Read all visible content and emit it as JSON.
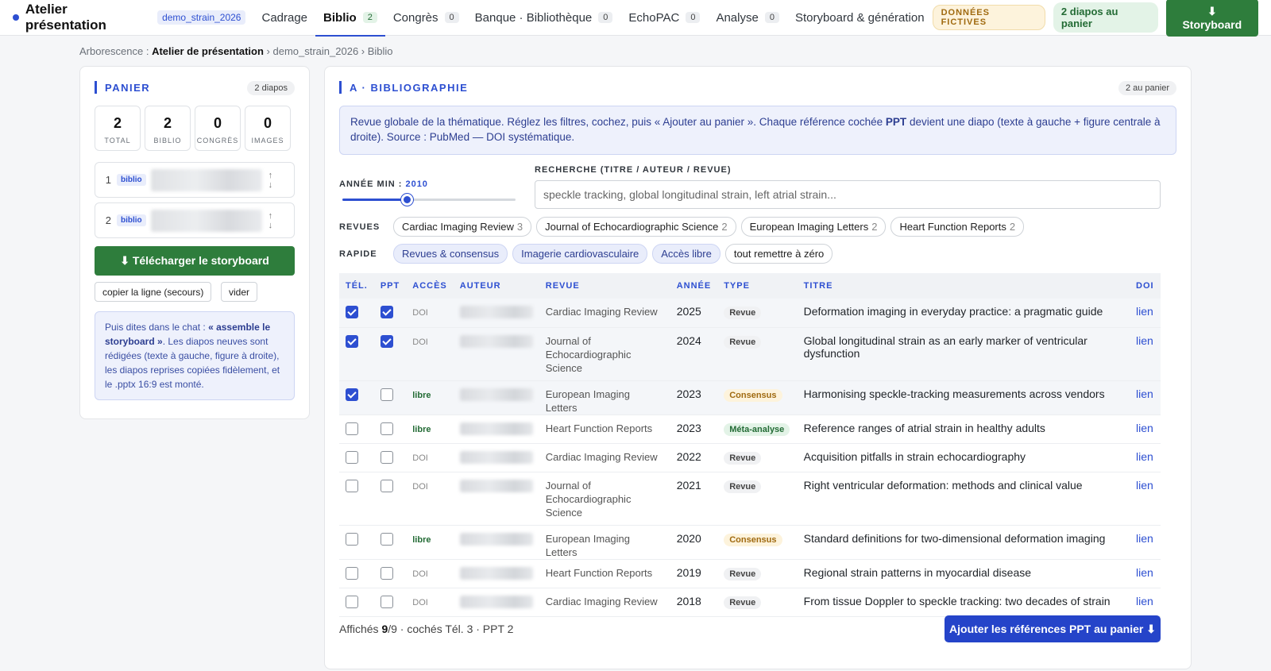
{
  "topbar": {
    "brand": "Atelier présentation",
    "project": "demo_strain_2026",
    "tabs": [
      {
        "label": "Cadrage",
        "count": null
      },
      {
        "label": "Biblio",
        "count": "2"
      },
      {
        "label": "Congrès",
        "count": "0"
      },
      {
        "label": "Banque · Bibliothèque",
        "count": "0"
      },
      {
        "label": "EchoPAC",
        "count": "0"
      },
      {
        "label": "Analyse",
        "count": "0"
      },
      {
        "label": "Storyboard & génération",
        "count": null
      }
    ],
    "fictive_badge": "DONNÉES FICTIVES",
    "cart_pill": "2 diapos au panier",
    "storyboard_button": "⬇ Storyboard"
  },
  "breadcrumb": {
    "prefix": "Arborescence :",
    "root": "Atelier de présentation",
    "path": " › demo_strain_2026 › Biblio"
  },
  "panier": {
    "title": "PANIER",
    "count": "2 diapos",
    "stats": [
      {
        "value": "2",
        "label": "TOTAL"
      },
      {
        "value": "2",
        "label": "BIBLIO"
      },
      {
        "value": "0",
        "label": "CONGRÈS"
      },
      {
        "value": "0",
        "label": "IMAGES"
      }
    ],
    "items": [
      {
        "index": "1",
        "type": "biblio"
      },
      {
        "index": "2",
        "type": "biblio"
      }
    ],
    "download_button": "⬇ Télécharger le storyboard",
    "copy_button": "copier la ligne (secours)",
    "clear_button": "vider",
    "hint_prefix": "Puis dites dans le chat : ",
    "hint_bold": "« assemble le storyboard »",
    "hint_suffix": ". Les diapos neuves sont rédigées (texte à gauche, figure à droite), les diapos reprises copiées fidèlement, et le .pptx 16:9 est monté."
  },
  "biblio": {
    "title": "A · BIBLIOGRAPHIE",
    "count": "2 au panier",
    "info_a": "Revue globale de la thématique. Réglez les filtres, cochez, puis « Ajouter au panier ». Chaque référence cochée ",
    "info_bold": "PPT",
    "info_b": " devient une diapo (texte à gauche + figure centrale à droite). Source : PubMed — DOI systématique.",
    "year_label": "ANNÉE MIN :",
    "year_value": "2010",
    "search_label": "RECHERCHE (TITRE / AUTEUR / REVUE)",
    "search_placeholder": "speckle tracking, global longitudinal strain, left atrial strain...",
    "revues_label": "REVUES",
    "revues": [
      {
        "name": "Cardiac Imaging Review",
        "count": "3"
      },
      {
        "name": "Journal of Echocardiographic Science",
        "count": "2"
      },
      {
        "name": "European Imaging Letters",
        "count": "2"
      },
      {
        "name": "Heart Function Reports",
        "count": "2"
      }
    ],
    "rapide_label": "RAPIDE",
    "rapide": [
      "Revues & consensus",
      "Imagerie cardiovasculaire",
      "Accès libre",
      "tout remettre à zéro"
    ],
    "columns": [
      "TÉL.",
      "PPT",
      "ACCÈS",
      "AUTEUR",
      "REVUE",
      "ANNÉE",
      "TYPE",
      "TITRE",
      "DOI"
    ],
    "rows": [
      {
        "tel": true,
        "ppt": true,
        "acces": "DOI",
        "revue": "Cardiac Imaging Review",
        "annee": "2025",
        "type": "Revue",
        "titre": "Deformation imaging in everyday practice: a pragmatic guide",
        "doi": "lien"
      },
      {
        "tel": true,
        "ppt": true,
        "acces": "DOI",
        "revue": "Journal of Echocardiographic Science",
        "annee": "2024",
        "type": "Revue",
        "titre": "Global longitudinal strain as an early marker of ventricular dysfunction",
        "doi": "lien"
      },
      {
        "tel": true,
        "ppt": false,
        "acces": "libre",
        "revue": "European Imaging Letters",
        "annee": "2023",
        "type": "Consensus",
        "titre": "Harmonising speckle-tracking measurements across vendors",
        "doi": "lien"
      },
      {
        "tel": false,
        "ppt": false,
        "acces": "libre",
        "revue": "Heart Function Reports",
        "annee": "2023",
        "type": "Méta-analyse",
        "titre": "Reference ranges of atrial strain in healthy adults",
        "doi": "lien"
      },
      {
        "tel": false,
        "ppt": false,
        "acces": "DOI",
        "revue": "Cardiac Imaging Review",
        "annee": "2022",
        "type": "Revue",
        "titre": "Acquisition pitfalls in strain echocardiography",
        "doi": "lien"
      },
      {
        "tel": false,
        "ppt": false,
        "acces": "DOI",
        "revue": "Journal of Echocardiographic Science",
        "annee": "2021",
        "type": "Revue",
        "titre": "Right ventricular deformation: methods and clinical value",
        "doi": "lien"
      },
      {
        "tel": false,
        "ppt": false,
        "acces": "libre",
        "revue": "European Imaging Letters",
        "annee": "2020",
        "type": "Consensus",
        "titre": "Standard definitions for two-dimensional deformation imaging",
        "doi": "lien"
      },
      {
        "tel": false,
        "ppt": false,
        "acces": "DOI",
        "revue": "Heart Function Reports",
        "annee": "2019",
        "type": "Revue",
        "titre": "Regional strain patterns in myocardial disease",
        "doi": "lien"
      },
      {
        "tel": false,
        "ppt": false,
        "acces": "DOI",
        "revue": "Cardiac Imaging Review",
        "annee": "2018",
        "type": "Revue",
        "titre": "From tissue Doppler to speckle tracking: two decades of strain",
        "doi": "lien"
      }
    ],
    "footer_prefix": "Affichés ",
    "footer_shown": "9",
    "footer_suffix": "/9 · cochés Tél. 3 · PPT 2",
    "add_button": "Ajouter les références PPT au panier ⬇"
  }
}
